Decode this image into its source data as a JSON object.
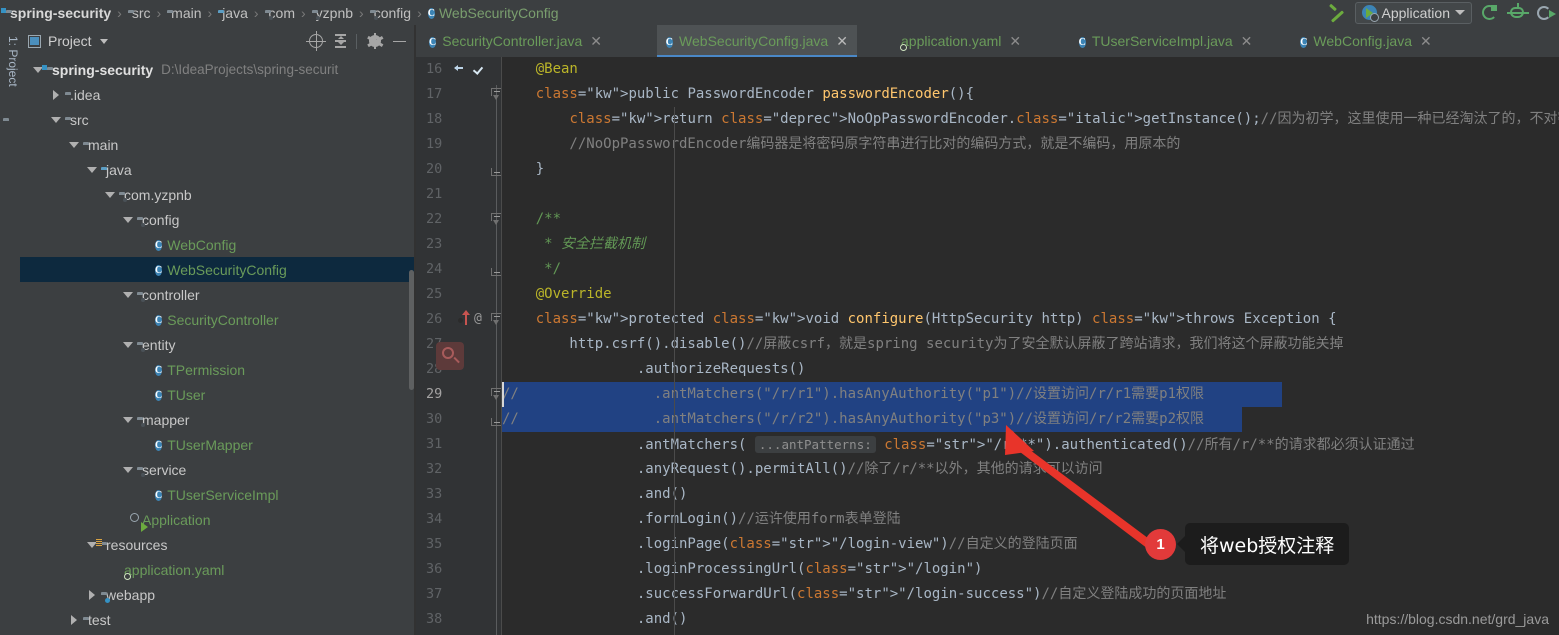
{
  "navbar": {
    "crumbs": [
      {
        "label": "spring-security",
        "icon": "module-folder-icon"
      },
      {
        "label": "src",
        "icon": "folder-icon"
      },
      {
        "label": "main",
        "icon": "folder-icon"
      },
      {
        "label": "java",
        "icon": "source-folder-icon"
      },
      {
        "label": "com",
        "icon": "package-icon"
      },
      {
        "label": "yzpnb",
        "icon": "package-icon"
      },
      {
        "label": "config",
        "icon": "package-icon"
      },
      {
        "label": "WebSecurityConfig",
        "icon": "java-class-icon"
      }
    ],
    "separator": "›"
  },
  "run_toolbar": {
    "build_tooltip": "Build",
    "config_name": "Application",
    "run_label": "Run",
    "debug_label": "Debug",
    "coverage_label": "Run with Coverage"
  },
  "left_tool_tabs": {
    "project_tab": "1: Project"
  },
  "project_panel": {
    "title": "Project",
    "toolbar": [
      "select-opened-file-icon",
      "collapse-all-icon",
      "settings-icon",
      "hide-icon"
    ],
    "tree": [
      {
        "depth": 0,
        "arrow": "open",
        "icon": "module-folder-icon",
        "label": "spring-security",
        "bold": true,
        "path": "D:\\IdeaProjects\\spring-securit"
      },
      {
        "depth": 1,
        "arrow": "closed",
        "icon": "folder-icon",
        "label": ".idea"
      },
      {
        "depth": 1,
        "arrow": "open",
        "icon": "folder-icon",
        "label": "src"
      },
      {
        "depth": 2,
        "arrow": "open",
        "icon": "folder-icon",
        "label": "main"
      },
      {
        "depth": 3,
        "arrow": "open",
        "icon": "source-folder-icon",
        "label": "java"
      },
      {
        "depth": 4,
        "arrow": "open",
        "icon": "package-icon",
        "label": "com.yzpnb"
      },
      {
        "depth": 5,
        "arrow": "open",
        "icon": "package-icon",
        "label": "config"
      },
      {
        "depth": 6,
        "arrow": "none",
        "icon": "java-class-icon",
        "label": "WebConfig",
        "green": true
      },
      {
        "depth": 6,
        "arrow": "none",
        "icon": "java-class-icon",
        "label": "WebSecurityConfig",
        "green": true,
        "selected": true
      },
      {
        "depth": 5,
        "arrow": "open",
        "icon": "package-icon",
        "label": "controller"
      },
      {
        "depth": 6,
        "arrow": "none",
        "icon": "java-class-icon",
        "label": "SecurityController",
        "green": true
      },
      {
        "depth": 5,
        "arrow": "open",
        "icon": "package-icon",
        "label": "entity"
      },
      {
        "depth": 6,
        "arrow": "none",
        "icon": "java-class-icon",
        "label": "TPermission",
        "green": true
      },
      {
        "depth": 6,
        "arrow": "none",
        "icon": "java-class-icon",
        "label": "TUser",
        "green": true
      },
      {
        "depth": 5,
        "arrow": "open",
        "icon": "package-icon",
        "label": "mapper"
      },
      {
        "depth": 6,
        "arrow": "none",
        "icon": "java-class-icon",
        "label": "TUserMapper",
        "green": true
      },
      {
        "depth": 5,
        "arrow": "open",
        "icon": "package-icon",
        "label": "service"
      },
      {
        "depth": 6,
        "arrow": "none",
        "icon": "java-class-icon",
        "label": "TUserServiceImpl",
        "green": true
      },
      {
        "depth": 5,
        "arrow": "none",
        "icon": "spring-boot-run-icon",
        "label": "Application",
        "green": true
      },
      {
        "depth": 3,
        "arrow": "open",
        "icon": "resources-folder-icon",
        "label": "resources"
      },
      {
        "depth": 4,
        "arrow": "none",
        "icon": "spring-yaml-icon",
        "label": "application.yaml",
        "green": true
      },
      {
        "depth": 3,
        "arrow": "closed",
        "icon": "web-folder-icon",
        "label": "webapp"
      },
      {
        "depth": 2,
        "arrow": "closed",
        "icon": "folder-icon",
        "label": "test"
      }
    ]
  },
  "editor_tabs": [
    {
      "label": "SecurityController.java",
      "icon": "java-class-icon",
      "active": false,
      "close": "✕"
    },
    {
      "label": "WebSecurityConfig.java",
      "icon": "java-class-icon",
      "active": true,
      "close": "✕"
    },
    {
      "label": "application.yaml",
      "icon": "spring-yaml-icon",
      "active": false,
      "close": "✕"
    },
    {
      "label": "TUserServiceImpl.java",
      "icon": "java-class-icon",
      "active": false,
      "close": "✕"
    },
    {
      "label": "WebConfig.java",
      "icon": "java-class-icon",
      "active": false,
      "close": "✕"
    }
  ],
  "editor": {
    "first_line": 16,
    "selected_lines": [
      29,
      30
    ],
    "caret_line": 29,
    "lines": [
      {
        "n": 16,
        "text": "    @Bean"
      },
      {
        "n": 17,
        "text": "    public PasswordEncoder passwordEncoder(){"
      },
      {
        "n": 18,
        "text": "        return NoOpPasswordEncoder.getInstance();//因为初学，这里使用一种已经淘汰了的，不对密码进行加密的编码器"
      },
      {
        "n": 19,
        "text": "        //NoOpPasswordEncoder编码器是将密码原字符串进行比对的编码方式，就是不编码，用原本的"
      },
      {
        "n": 20,
        "text": "    }"
      },
      {
        "n": 21,
        "text": ""
      },
      {
        "n": 22,
        "text": "    /**"
      },
      {
        "n": 23,
        "text": "     * 安全拦截机制"
      },
      {
        "n": 24,
        "text": "     */"
      },
      {
        "n": 25,
        "text": "    @Override"
      },
      {
        "n": 26,
        "text": "    protected void configure(HttpSecurity http) throws Exception {"
      },
      {
        "n": 27,
        "text": "        http.csrf().disable()//屏蔽csrf，就是spring security为了安全默认屏蔽了跨站请求，我们将这个屏蔽功能关掉"
      },
      {
        "n": 28,
        "text": "                .authorizeRequests()"
      },
      {
        "n": 29,
        "text": "//                .antMatchers(\"/r/r1\").hasAnyAuthority(\"p1\")//设置访问/r/r1需要p1权限"
      },
      {
        "n": 30,
        "text": "//                .antMatchers(\"/r/r2\").hasAnyAuthority(\"p3\")//设置访问/r/r2需要p2权限"
      },
      {
        "n": 31,
        "text": "                .antMatchers( ...antPatterns: \"/r/**\").authenticated()//所有/r/**的请求都必须认证通过"
      },
      {
        "n": 32,
        "text": "                .anyRequest().permitAll()//除了/r/**以外，其他的请求可以访问"
      },
      {
        "n": 33,
        "text": "                .and()"
      },
      {
        "n": 34,
        "text": "                .formLogin()//运许使用form表单登陆"
      },
      {
        "n": 35,
        "text": "                .loginPage(\"/login-view\")//自定义的登陆页面"
      },
      {
        "n": 36,
        "text": "                .loginProcessingUrl(\"/login\")"
      },
      {
        "n": 37,
        "text": "                .successForwardUrl(\"/login-success\")//自定义登陆成功的页面地址"
      },
      {
        "n": 38,
        "text": "                .and()"
      }
    ],
    "inlay_hint": "...antPatterns:",
    "gutter_glyphs": {
      "line16": [
        "spring-bean-arrow-icon",
        "spring-bean-check-icon"
      ],
      "line26": [
        "overriding-method-icon",
        "annotation-marker-icon"
      ],
      "line27": [
        "search-highlight-icon"
      ]
    }
  },
  "annotation": {
    "badge_number": "1",
    "callout_text": "将web授权注释",
    "arrow_color": "#e8342a"
  },
  "watermark": "https://blog.csdn.net/grd_java",
  "colors": {
    "chrome_bg": "#3c3f41",
    "editor_bg": "#2b2b2b",
    "gutter_bg": "#313335",
    "selection": "#214283",
    "tree_selection": "#0d293e",
    "tab_underline": "#4a88c7",
    "green_text": "#6a9b5a",
    "accent_red": "#e23a3a"
  }
}
